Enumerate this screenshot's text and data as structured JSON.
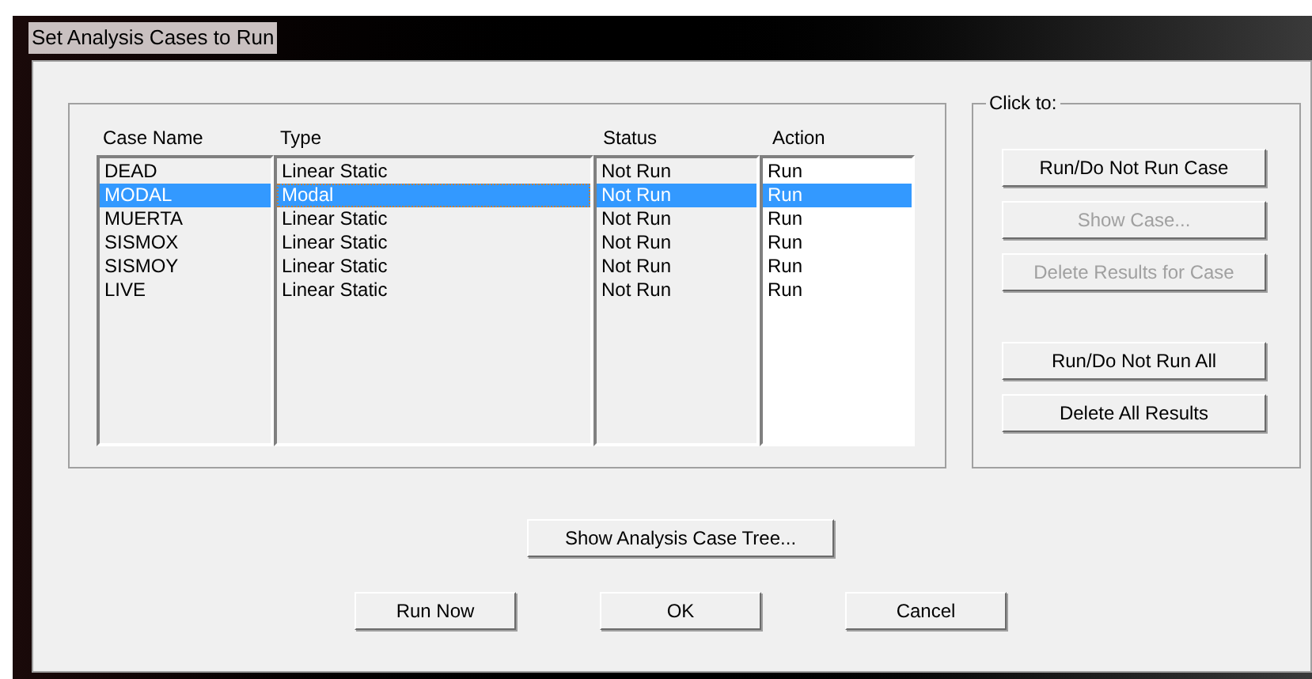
{
  "window": {
    "title": "Set Analysis Cases to Run"
  },
  "table": {
    "columns": [
      "Case Name",
      "Type",
      "Status",
      "Action"
    ],
    "rows": [
      {
        "cells": [
          "DEAD",
          "Linear Static",
          "Not Run",
          "Run"
        ],
        "selected": false
      },
      {
        "cells": [
          "MODAL",
          "Modal",
          "Not Run",
          "Run"
        ],
        "selected": true
      },
      {
        "cells": [
          "MUERTA",
          "Linear Static",
          "Not Run",
          "Run"
        ],
        "selected": false
      },
      {
        "cells": [
          "SISMOX",
          "Linear Static",
          "Not Run",
          "Run"
        ],
        "selected": false
      },
      {
        "cells": [
          "SISMOY",
          "Linear Static",
          "Not Run",
          "Run"
        ],
        "selected": false
      },
      {
        "cells": [
          "LIVE",
          "Linear Static",
          "Not Run",
          "Run"
        ],
        "selected": false
      }
    ]
  },
  "click_to": {
    "title": "Click to:",
    "buttons": [
      {
        "label": "Run/Do Not Run Case",
        "disabled": false
      },
      {
        "label": "Show Case...",
        "disabled": true
      },
      {
        "label": "Delete Results for Case",
        "disabled": true
      },
      {
        "label": "Run/Do Not Run All",
        "disabled": false
      },
      {
        "label": "Delete All Results",
        "disabled": false
      }
    ]
  },
  "tree_button": "Show Analysis Case Tree...",
  "footer_buttons": [
    "Run Now",
    "OK",
    "Cancel"
  ]
}
